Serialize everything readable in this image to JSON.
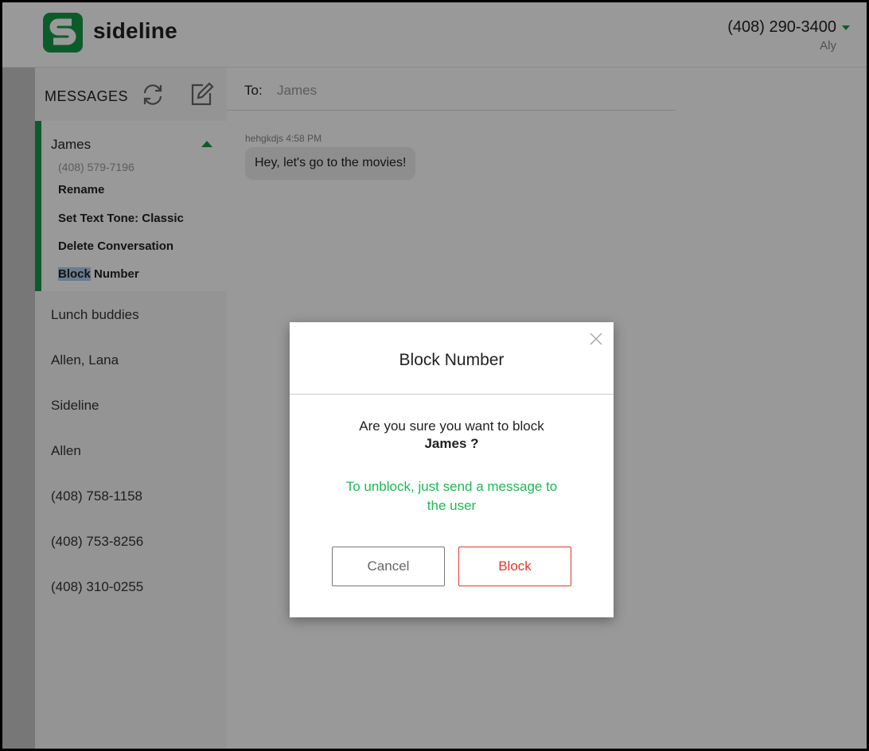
{
  "header": {
    "logo_text": "sideline",
    "account_number": "(408) 290-3400",
    "account_name": "Aly"
  },
  "sidebar": {
    "title": "MESSAGES",
    "active_conversation": {
      "name": "James",
      "phone": "(408) 579-7196",
      "menu": {
        "rename": "Rename",
        "text_tone": "Set Text Tone: Classic",
        "delete": "Delete Conversation",
        "block_selected": "Block",
        "block_rest": " Number"
      }
    },
    "conversations": [
      "Lunch buddies",
      "Allen, Lana",
      "Sideline",
      "Allen",
      "(408) 758-1158",
      "(408) 753-8256",
      "(408) 310-0255"
    ]
  },
  "chat": {
    "to_label": "To:",
    "to_value": "James",
    "message": {
      "meta": "hehgkdjs 4:58 PM",
      "text": "Hey, let's go to the movies!"
    }
  },
  "modal": {
    "title": "Block Number",
    "confirm_text": "Are you sure you want to block",
    "confirm_name": "James ?",
    "hint": "To unblock, just send a message to the user",
    "cancel_label": "Cancel",
    "block_label": "Block"
  },
  "colors": {
    "brand_green": "#159947",
    "hint_green": "#1db954",
    "danger_red": "#e8362a"
  }
}
